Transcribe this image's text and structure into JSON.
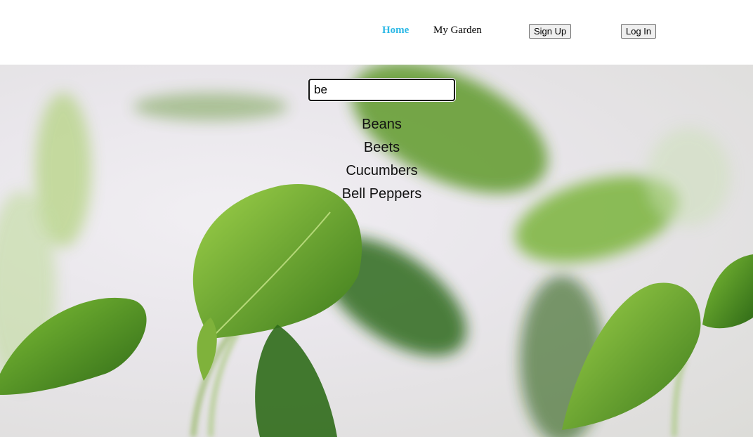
{
  "nav": {
    "home": "Home",
    "my_garden": "My Garden",
    "sign_up": "Sign Up",
    "log_in": "Log In"
  },
  "search": {
    "value": "be"
  },
  "suggestions": [
    "Beans",
    "Beets",
    "Cucumbers",
    "Bell Peppers"
  ],
  "colors": {
    "accent": "#2bb8e6",
    "leaf_dark": "#3f7a1e",
    "leaf_light": "#8cc63f"
  }
}
